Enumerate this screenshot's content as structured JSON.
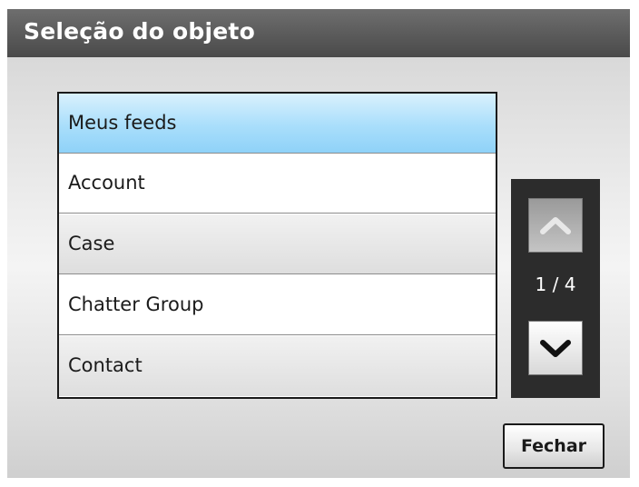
{
  "dialog": {
    "title": "Seleção do objeto"
  },
  "list": {
    "items": [
      {
        "label": "Meus feeds"
      },
      {
        "label": "Account"
      },
      {
        "label": "Case"
      },
      {
        "label": "Chatter Group"
      },
      {
        "label": "Contact"
      }
    ],
    "selected": "Meus feeds"
  },
  "pager": {
    "page_text": "1 / 4",
    "up_icon": "chevron-up-icon",
    "down_icon": "chevron-down-icon"
  },
  "buttons": {
    "close_label": "Fechar"
  },
  "colors": {
    "titlebar": "#4a4a4a",
    "selected_item": "#a9defb",
    "pager_bg": "#2c2c2c"
  }
}
